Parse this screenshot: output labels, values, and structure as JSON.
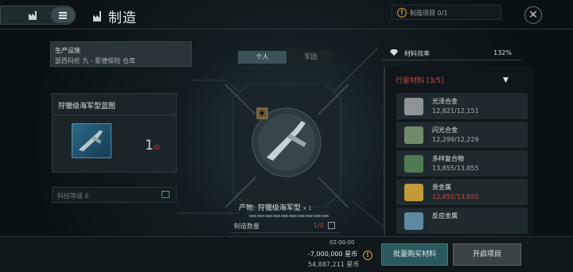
{
  "header": {
    "title": "制造",
    "task_label": "制造项目 0/1",
    "close_glyph": "✕"
  },
  "facility": {
    "label": "生产设施",
    "location": "瑟西玛伦 九 - 影德保险 仓库"
  },
  "blueprint": {
    "name": "狩獵级海军型蓝图",
    "count": "1",
    "count_sub": "/0"
  },
  "tech_level": {
    "label": "科技等级 6"
  },
  "tabs": [
    {
      "label": "个人"
    },
    {
      "label": "军团"
    }
  ],
  "product": {
    "label": "产物:",
    "name": "狩獵级海军型",
    "mult": "x 1"
  },
  "quantity": {
    "label": "制造数量",
    "value": "1/0"
  },
  "efficiency": {
    "label": "材料效率",
    "value": "132%"
  },
  "materials": {
    "header": "行星材料 [3/5]",
    "items": [
      {
        "name": "光泽合金",
        "qty": "12,821/12,151",
        "shortage": false,
        "color": "#8c9496"
      },
      {
        "name": "闪光合金",
        "qty": "12,299/12,229",
        "shortage": false,
        "color": "#6f8a6a"
      },
      {
        "name": "多样复合物",
        "qty": "13,855/13,855",
        "shortage": false,
        "color": "#4f7a52"
      },
      {
        "name": "贵金属",
        "qty": "12,655/13,855",
        "shortage": true,
        "color": "#c29a3a"
      },
      {
        "name": "反应金属",
        "qty": "",
        "shortage": false,
        "color": "#5c8aa0"
      }
    ]
  },
  "footer": {
    "time": "02:00:00",
    "cost": "-7,000,000 星币",
    "balance": "54,887,211 星币",
    "bulk_buy": "批量购买材料",
    "start": "开启项目"
  },
  "colors": {
    "accent_red": "#c94848",
    "teal_button": "#2a5a5e",
    "warning": "#e29a3a"
  }
}
